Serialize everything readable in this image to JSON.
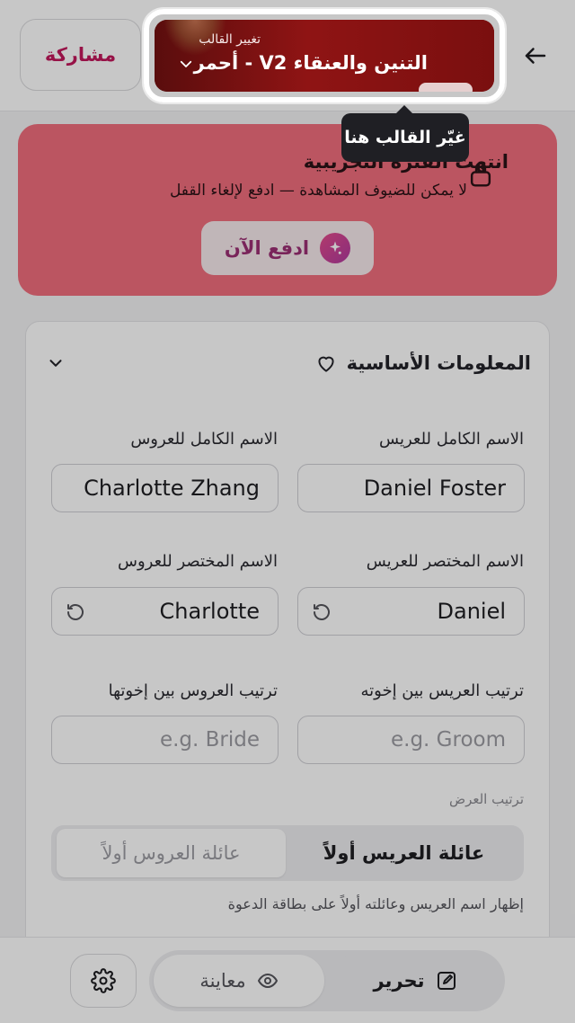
{
  "header": {
    "share_label": "مشاركة",
    "template": {
      "caption": "تغيير القالب",
      "name": "التنين والعنقاء V2 - أحمر"
    }
  },
  "tooltip": {
    "text": "غيّر القالب هنا"
  },
  "trial": {
    "title": "انتهت الفترة التجريبية",
    "subtitle": "لا يمكن للضيوف المشاهدة — ادفع لإلغاء القفل",
    "pay_label": "ادفع الآن"
  },
  "basic_info": {
    "section_title": "المعلومات الأساسية",
    "groom_full_name": {
      "label": "الاسم الكامل للعريس",
      "value": "Daniel Foster"
    },
    "bride_full_name": {
      "label": "الاسم الكامل للعروس",
      "value": "Charlotte Zhang"
    },
    "groom_short_name": {
      "label": "الاسم المختصر للعريس",
      "value": "Daniel"
    },
    "bride_short_name": {
      "label": "الاسم المختصر للعروس",
      "value": "Charlotte"
    },
    "groom_rank": {
      "label": "ترتيب العريس بين إخوته",
      "placeholder": "e.g. Groom"
    },
    "bride_rank": {
      "label": "ترتيب العروس بين إخوتها",
      "placeholder": "e.g. Bride"
    },
    "display_order": {
      "label": "ترتيب العرض",
      "options": [
        "عائلة العريس أولاً",
        "عائلة العروس أولاً"
      ],
      "selected": "عائلة العريس أولاً",
      "help": "إظهار اسم العريس وعائلته أولاً على بطاقة الدعوة"
    }
  },
  "bottom_bar": {
    "edit_label": "تحرير",
    "preview_label": "معاينة"
  },
  "colors": {
    "accent": "#c2185b",
    "banner": "#f06d7d",
    "template_bg": "#8f1414"
  }
}
